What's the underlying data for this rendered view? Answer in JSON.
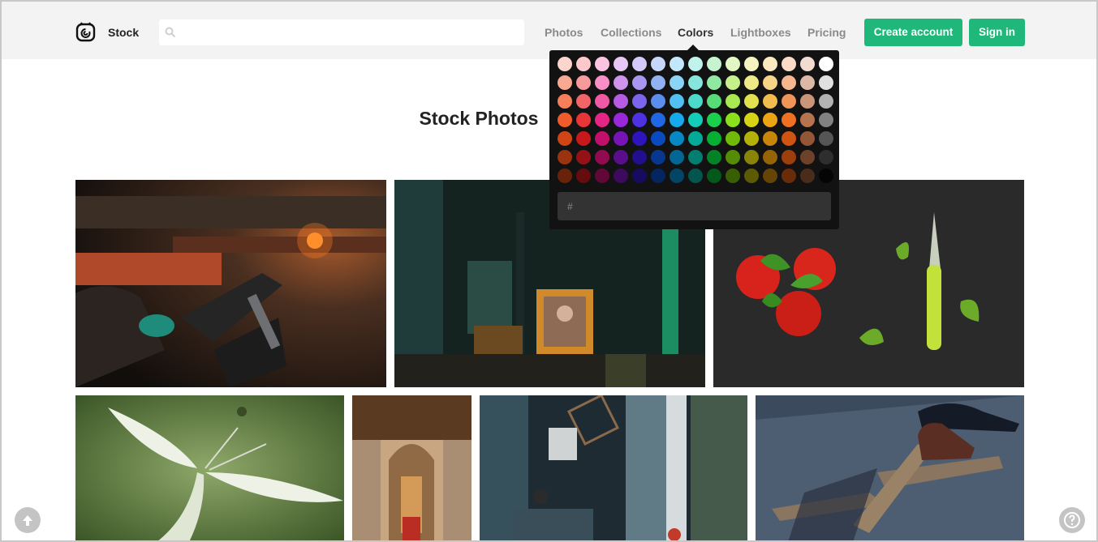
{
  "header": {
    "brand": "Stock",
    "search": {
      "placeholder": "",
      "value": ""
    },
    "nav": [
      "Photos",
      "Collections",
      "Colors",
      "Lightboxes",
      "Pricing"
    ],
    "active_nav": "Colors",
    "create_account": "Create account",
    "sign_in": "Sign in",
    "accent": "#1fb87a"
  },
  "main": {
    "title": "Stock Photos",
    "photos": [
      {
        "subject": "welder",
        "icon": "photo-welder"
      },
      {
        "subject": "antique shop",
        "icon": "photo-antique-shop"
      },
      {
        "subject": "tomatoes and basil",
        "icon": "photo-tomatoes"
      },
      {
        "subject": "moth",
        "icon": "photo-moth"
      },
      {
        "subject": "cathedral",
        "icon": "photo-cathedral"
      },
      {
        "subject": "interior",
        "icon": "photo-interior"
      },
      {
        "subject": "shoes",
        "icon": "photo-shoes"
      }
    ]
  },
  "color_picker": {
    "hex_label": "#",
    "hex_value": "",
    "colors": [
      [
        "#fcd5cc",
        "#fbc9cc",
        "#fbc5e2",
        "#e7c7f6",
        "#d4c9f8",
        "#c7d7f9",
        "#c4e8fb",
        "#c2f2ed",
        "#c7f4d0",
        "#e2f7c4",
        "#f5f4c1",
        "#fbe9bf",
        "#fbdbc8",
        "#f1dcd2",
        "#ffffff"
      ],
      [
        "#f9a891",
        "#f8999c",
        "#f78ec5",
        "#cf92ed",
        "#a896f1",
        "#90b2f3",
        "#8ad4f6",
        "#86e5dc",
        "#90e9a3",
        "#c5f08a",
        "#eceb86",
        "#f6d387",
        "#f6b78f",
        "#dcb9a6",
        "#e0e0e0"
      ],
      [
        "#f47f5a",
        "#f16468",
        "#f05aa5",
        "#b65ce4",
        "#7c65ea",
        "#5a8dec",
        "#52c0f1",
        "#4ed8cb",
        "#58dc77",
        "#a7e853",
        "#e2e04e",
        "#f0bc4d",
        "#f19458",
        "#c99679",
        "#b2b2b2"
      ],
      [
        "#ef5b2a",
        "#e83538",
        "#e52585",
        "#9a27da",
        "#4e31e2",
        "#2167e4",
        "#16a9eb",
        "#14ccba",
        "#1ad04c",
        "#8be01c",
        "#d8d415",
        "#eba514",
        "#ee7022",
        "#b5734e",
        "#818181"
      ],
      [
        "#cf4516",
        "#c7181c",
        "#c20f6b",
        "#7714b7",
        "#2d14bd",
        "#0b49bf",
        "#0588c4",
        "#05a997",
        "#06ae33",
        "#70bb0a",
        "#b4b00a",
        "#c7860a",
        "#cf5412",
        "#935738",
        "#555555"
      ],
      [
        "#9c3310",
        "#941215",
        "#920b51",
        "#590f89",
        "#210f8e",
        "#08378f",
        "#046693",
        "#037f71",
        "#048326",
        "#548c07",
        "#878407",
        "#956407",
        "#9c3f0d",
        "#6e412a",
        "#2e2e2e"
      ],
      [
        "#6a230b",
        "#650c0e",
        "#630737",
        "#3d0a5d",
        "#160a61",
        "#052561",
        "#034564",
        "#02564d",
        "#02591a",
        "#395f05",
        "#5c5a05",
        "#654405",
        "#6a2b09",
        "#4a2c1c",
        "#050505"
      ]
    ]
  }
}
